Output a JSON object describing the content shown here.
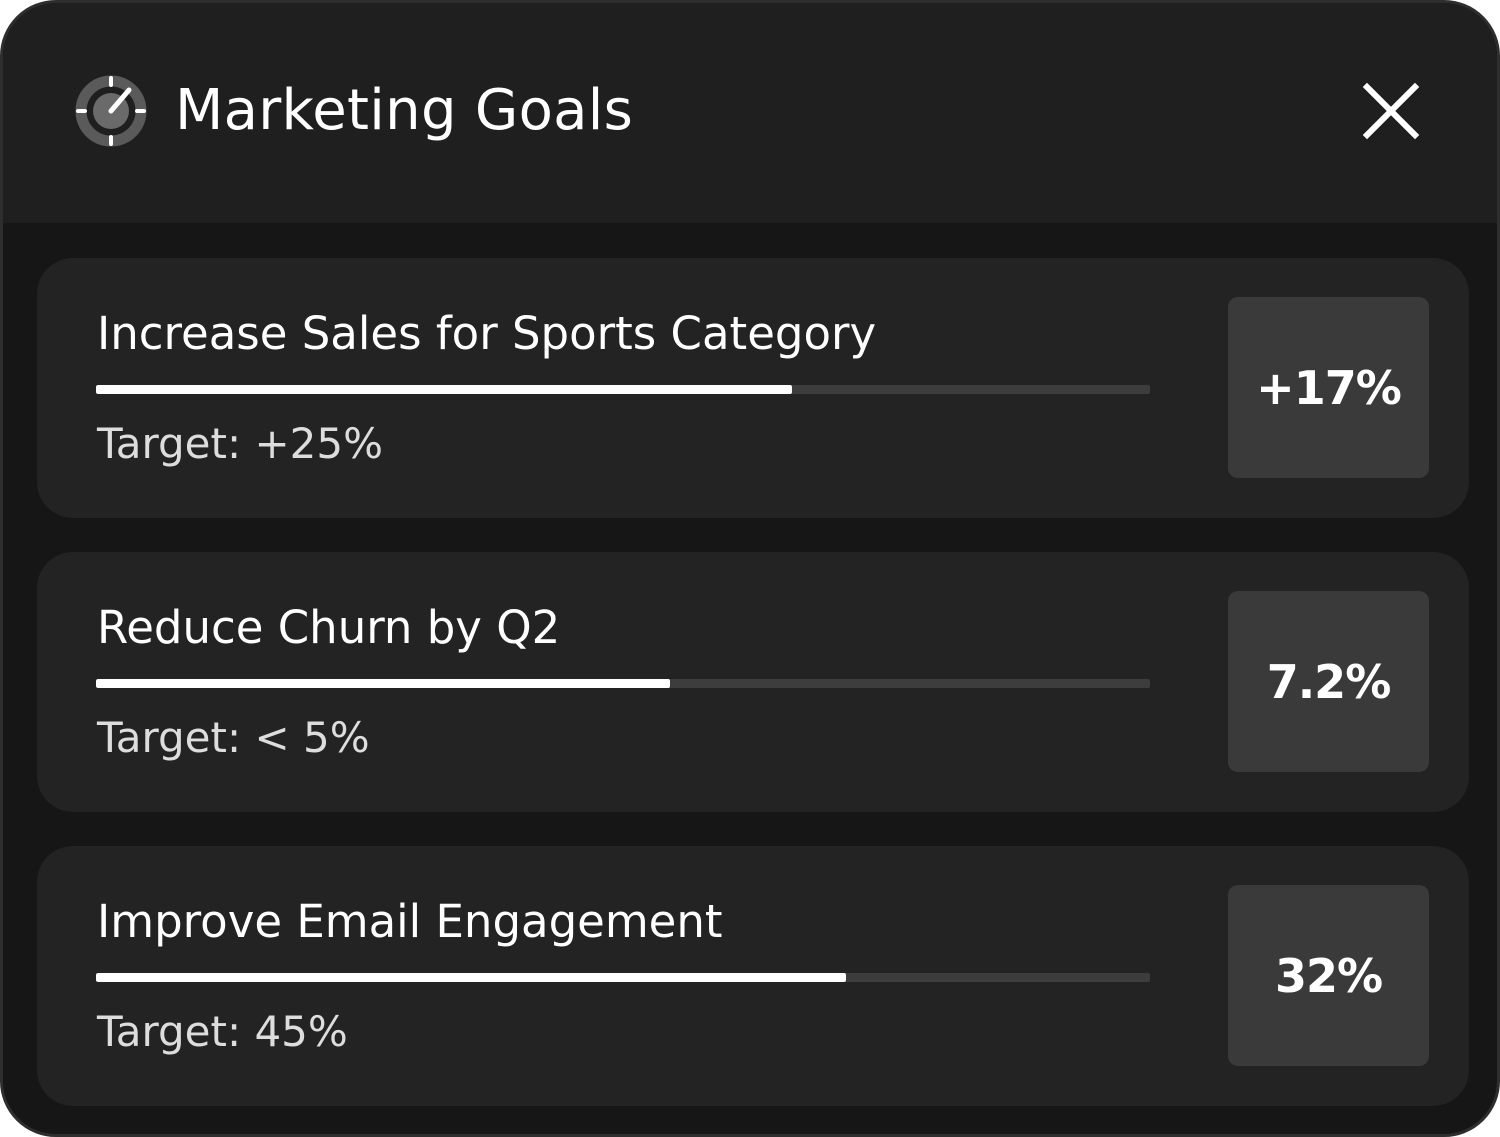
{
  "header": {
    "title": "Marketing Goals",
    "icon": "target-icon",
    "close_icon": "close-icon"
  },
  "colors": {
    "panel_bg": "#161616",
    "header_bg": "#1f1f1f",
    "card_bg": "#232323",
    "value_box_bg": "#3a3a3a",
    "progress_fill": "#ffffff",
    "progress_track": "#3d3d3d"
  },
  "goals": [
    {
      "title": "Increase Sales for Sports Category",
      "target": "Target: +25%",
      "value": "+17%",
      "progress": 0.66
    },
    {
      "title": "Reduce Churn by Q2",
      "target": "Target: < 5%",
      "value": "7.2%",
      "progress": 0.545
    },
    {
      "title": "Improve Email Engagement",
      "target": "Target: 45%",
      "value": "32%",
      "progress": 0.712
    }
  ]
}
